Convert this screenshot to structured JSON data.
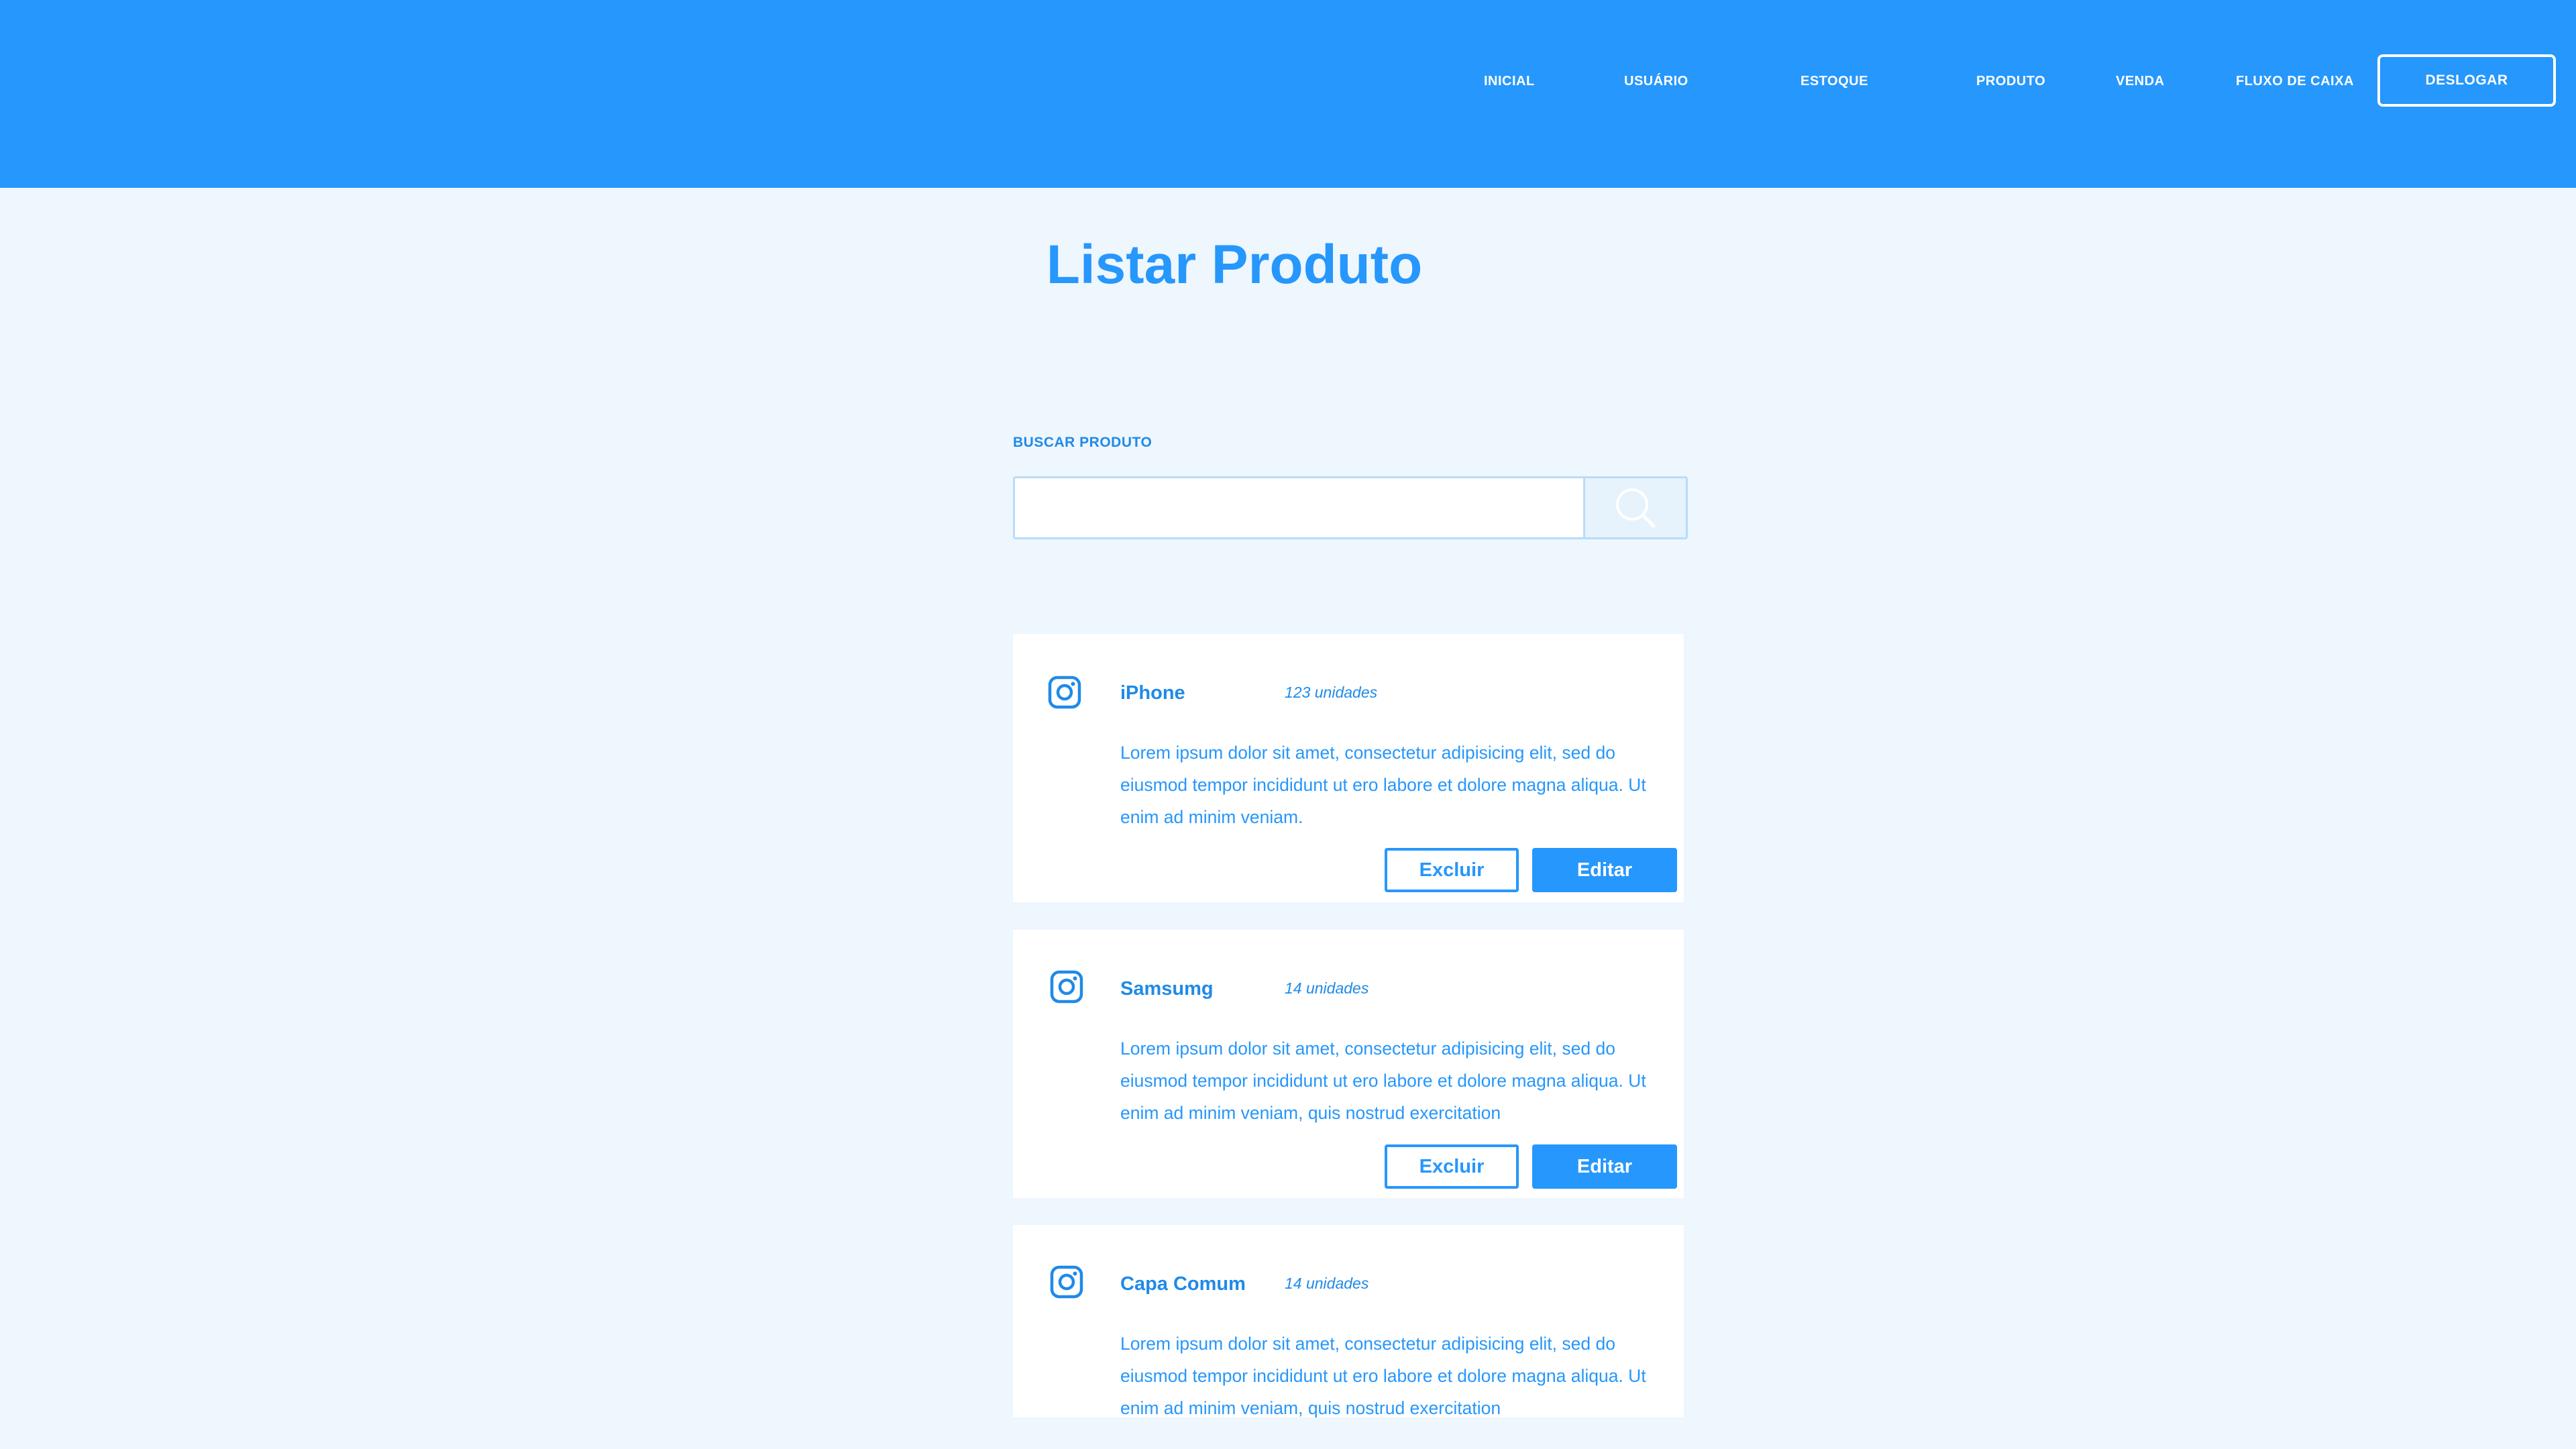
{
  "nav": {
    "items": [
      {
        "label": "INICIAL"
      },
      {
        "label": "USUÁRIO"
      },
      {
        "label": "ESTOQUE"
      },
      {
        "label": "PRODUTO"
      },
      {
        "label": "VENDA"
      },
      {
        "label": "FLUXO DE CAIXA"
      }
    ],
    "logout_label": "DESLOGAR"
  },
  "page": {
    "title": "Listar Produto"
  },
  "search": {
    "label": "BUSCAR PRODUTO",
    "value": "",
    "placeholder": "",
    "button_icon": "search-icon"
  },
  "products": [
    {
      "icon": "instagram-icon",
      "name": "iPhone",
      "quantity": "123 unidades",
      "description": "Lorem ipsum dolor sit amet, consectetur adipisicing elit, sed do eiusmod tempor incididunt ut ero labore et dolore magna aliqua. Ut enim ad minim veniam.",
      "delete_label": "Excluir",
      "edit_label": "Editar"
    },
    {
      "icon": "instagram-icon",
      "name": "Samsumg",
      "quantity": "14 unidades",
      "description": "Lorem ipsum dolor sit amet, consectetur adipisicing elit, sed do eiusmod tempor incididunt ut ero labore et dolore magna aliqua. Ut enim ad minim veniam, quis nostrud exercitation",
      "delete_label": "Excluir",
      "edit_label": "Editar"
    },
    {
      "icon": "instagram-icon",
      "name": "Capa Comum",
      "quantity": "14 unidades",
      "description": "Lorem ipsum dolor sit amet, consectetur adipisicing elit, sed do eiusmod tempor incididunt ut ero labore et dolore magna aliqua. Ut enim ad minim veniam, quis nostrud exercitation"
    }
  ],
  "colors": {
    "primary": "#2697fc",
    "background": "#eef6fe",
    "card": "#ffffff",
    "input_border": "#b8dcf8"
  }
}
